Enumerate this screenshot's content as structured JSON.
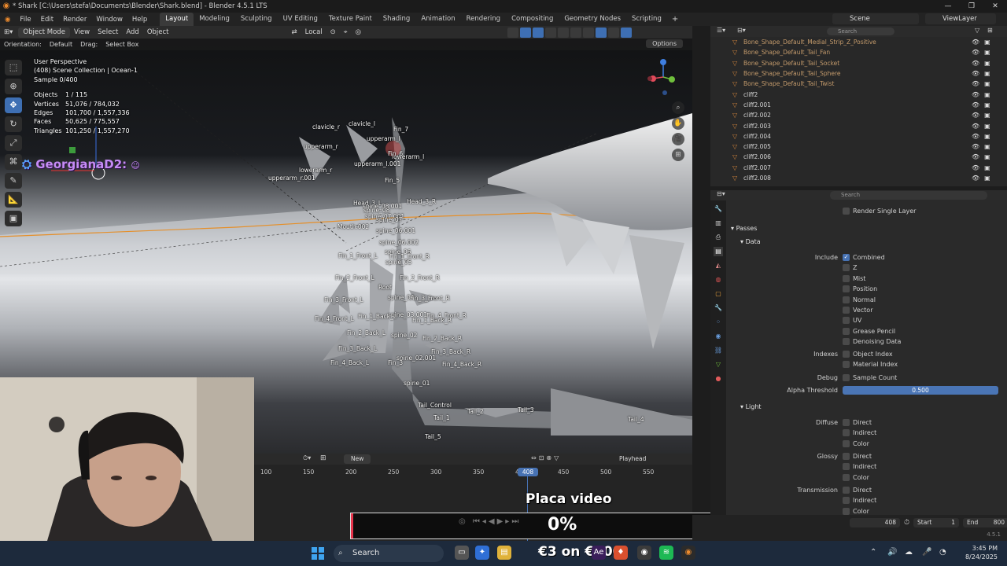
{
  "window": {
    "title": "* Shark [C:\\Users\\stefa\\Documents\\Blender\\Shark.blend] - Blender 4.5.1 LTS",
    "minimize": "—",
    "maximize": "❐",
    "close": "✕"
  },
  "menu": {
    "items": [
      "File",
      "Edit",
      "Render",
      "Window",
      "Help"
    ],
    "workspaces": [
      "Layout",
      "Modeling",
      "Sculpting",
      "UV Editing",
      "Texture Paint",
      "Shading",
      "Animation",
      "Rendering",
      "Compositing",
      "Geometry Nodes",
      "Scripting"
    ],
    "active_workspace": "Layout",
    "add_workspace": "+"
  },
  "scene": {
    "name": "Scene",
    "view_layer": "ViewLayer"
  },
  "viewport_header": {
    "mode": "Object Mode",
    "menus": [
      "View",
      "Select",
      "Add",
      "Object"
    ],
    "transform_space": "Local"
  },
  "tool_header": {
    "orientation_label": "Orientation:",
    "orientation_value": "Default",
    "drag_label": "Drag:",
    "drag_value": "Select Box",
    "options": "Options"
  },
  "viewport_overlay": {
    "view_name": "User Perspective",
    "collection": "(408) Scene Collection | Ocean-1",
    "sample": "Sample 0/400",
    "stats": [
      {
        "label": "Objects",
        "value": "1 / 115"
      },
      {
        "label": "Vertices",
        "value": "51,076 / 784,032"
      },
      {
        "label": "Edges",
        "value": "101,700 / 1,557,336"
      },
      {
        "label": "Faces",
        "value": "50,625 / 775,557"
      },
      {
        "label": "Triangles",
        "value": "101,250 / 1,557,270"
      }
    ]
  },
  "streamer_overlay": {
    "name": "GeorgianaD2:"
  },
  "bones": [
    "clavicle_r",
    "clavicle_l",
    "Fin_7",
    "upperarm_r",
    "upperarm_l",
    "lowerarm_l",
    "upperarm_l.001",
    "upperarm_r.001",
    "lowerarm_r",
    "Fin_6",
    "Fin_5",
    "Head_3_L",
    "Head_3_R",
    "spine_08.001",
    "spine_08",
    "spine_07.001",
    "spine_07",
    "Mouth.002",
    "spine_06.001",
    "spine_06.002",
    "spine_06",
    "Fin_1_Front_L",
    "Fin_1_Front_R",
    "spine_05",
    "Fin_2_Front_L",
    "Fin_2_Front_R",
    "Root",
    "Fin_3_Front_L",
    "spine_04",
    "Fin_3_Front_R",
    "spine_03.001",
    "Fin_4_Front_R",
    "Fin_4_Front_L",
    "Fin_1_Back_L",
    "Fin_1_Back_R",
    "Fin_2_Back_L",
    "spine_02",
    "Fin_2_Back_R",
    "Fin_3_Back_L",
    "Fin_3_Back_R",
    "spine_02.001",
    "Fin_4_Back_L",
    "Fin_3",
    "Fin_4_Back_R",
    "spine_01",
    "Tail_Control",
    "Tail_1",
    "Tail_2",
    "Tail_3",
    "Tail_4",
    "Tail_5"
  ],
  "timeline": {
    "new_button": "New",
    "playhead_label": "Playhead",
    "ticks": [
      "100",
      "150",
      "200",
      "250",
      "300",
      "350",
      "400",
      "450",
      "500",
      "550"
    ],
    "current_frame": "408",
    "frame_field_label_current": "408",
    "start_label": "Start",
    "start_value": "1",
    "end_label": "End",
    "end_value": "800"
  },
  "stream_overlay": {
    "placa_label": "Placa video",
    "progress_percent": "0%",
    "progress_fraction": 0
  },
  "outliner": {
    "search_placeholder": "Search",
    "items": [
      "Bone_Shape_Default_Medial_Strip_Z_Positive",
      "Bone_Shape_Default_Tail_Fan",
      "Bone_Shape_Default_Tail_Socket",
      "Bone_Shape_Default_Tail_Sphere",
      "Bone_Shape_Default_Tail_Twist",
      "cliff2",
      "cliff2.001",
      "cliff2.002",
      "cliff2.003",
      "cliff2.004",
      "cliff2.005",
      "cliff2.006",
      "cliff2.007",
      "cliff2.008"
    ]
  },
  "properties": {
    "search_placeholder": "Search",
    "render_single_layer": "Render Single Layer",
    "passes_section": "Passes",
    "data_section": "Data",
    "include_label": "Include",
    "include_options": [
      {
        "label": "Combined",
        "checked": true
      },
      {
        "label": "Z",
        "checked": false
      },
      {
        "label": "Mist",
        "checked": false
      },
      {
        "label": "Position",
        "checked": false
      },
      {
        "label": "Normal",
        "checked": false
      },
      {
        "label": "Vector",
        "checked": false
      },
      {
        "label": "UV",
        "checked": false
      },
      {
        "label": "Grease Pencil",
        "checked": false
      },
      {
        "label": "Denoising Data",
        "checked": false
      }
    ],
    "indexes_label": "Indexes",
    "index_options": [
      "Object Index",
      "Material Index"
    ],
    "debug_label": "Debug",
    "debug_option": "Sample Count",
    "alpha_label": "Alpha Threshold",
    "alpha_value": "0.500",
    "light_section": "Light",
    "diffuse_label": "Diffuse",
    "glossy_label": "Glossy",
    "transmission_label": "Transmission",
    "light_options": [
      "Direct",
      "Indirect",
      "Color"
    ]
  },
  "status": {
    "version": "4.5.1"
  },
  "taskbar": {
    "search_label": "Search",
    "price_overlay": "€3 on €600",
    "time": "3:45 PM",
    "date": "8/24/2025"
  },
  "colors": {
    "accent_blue": "#4772b3",
    "blender_orange": "#ec8a2d",
    "streamer_purple": "#c58cf5",
    "progress_red": "#e5334b"
  }
}
